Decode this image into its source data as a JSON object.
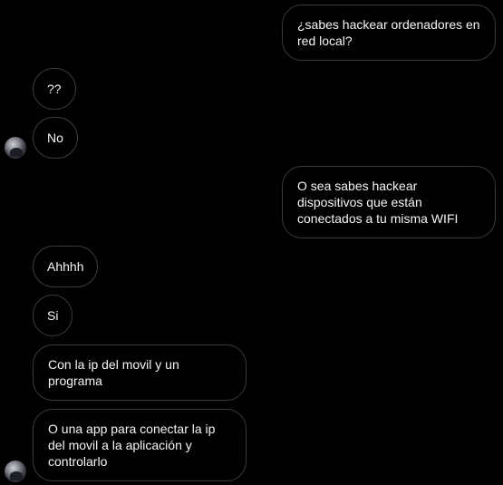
{
  "messages": [
    {
      "side": "right",
      "text": "¿sabes hackear ordenadores en red local?"
    },
    {
      "side": "left",
      "text": "??"
    },
    {
      "side": "left",
      "text": "No"
    },
    {
      "side": "right",
      "text": "O sea sabes hackear dispositivos que están conectados a tu misma WIFI"
    },
    {
      "side": "left",
      "text": "Ahhhh"
    },
    {
      "side": "left",
      "text": "Si"
    },
    {
      "side": "left",
      "text": "Con la ip del movil y un programa"
    },
    {
      "side": "left",
      "text": "O una app para conectar la ip del movil a la aplicación y controlarlo"
    }
  ]
}
